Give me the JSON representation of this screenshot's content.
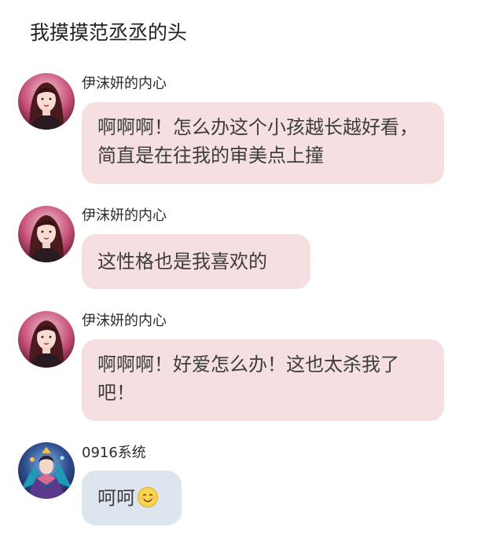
{
  "title": "我摸摸范丞丞的头",
  "messages": [
    {
      "sender": "伊沫妍的内心",
      "text": "啊啊啊！怎么办这个小孩越长越好看，简直是在往我的审美点上撞"
    },
    {
      "sender": "伊沫妍的内心",
      "text": "这性格也是我喜欢的"
    },
    {
      "sender": "伊沫妍的内心",
      "text": "啊啊啊！好爱怎么办！这也太杀我了吧！"
    },
    {
      "sender": "0916系统",
      "text": "呵呵",
      "emoji": "smiling-face-emoji"
    }
  ],
  "colors": {
    "pink_bubble": "#f5dfe1",
    "blue_bubble": "#dde5ef"
  }
}
